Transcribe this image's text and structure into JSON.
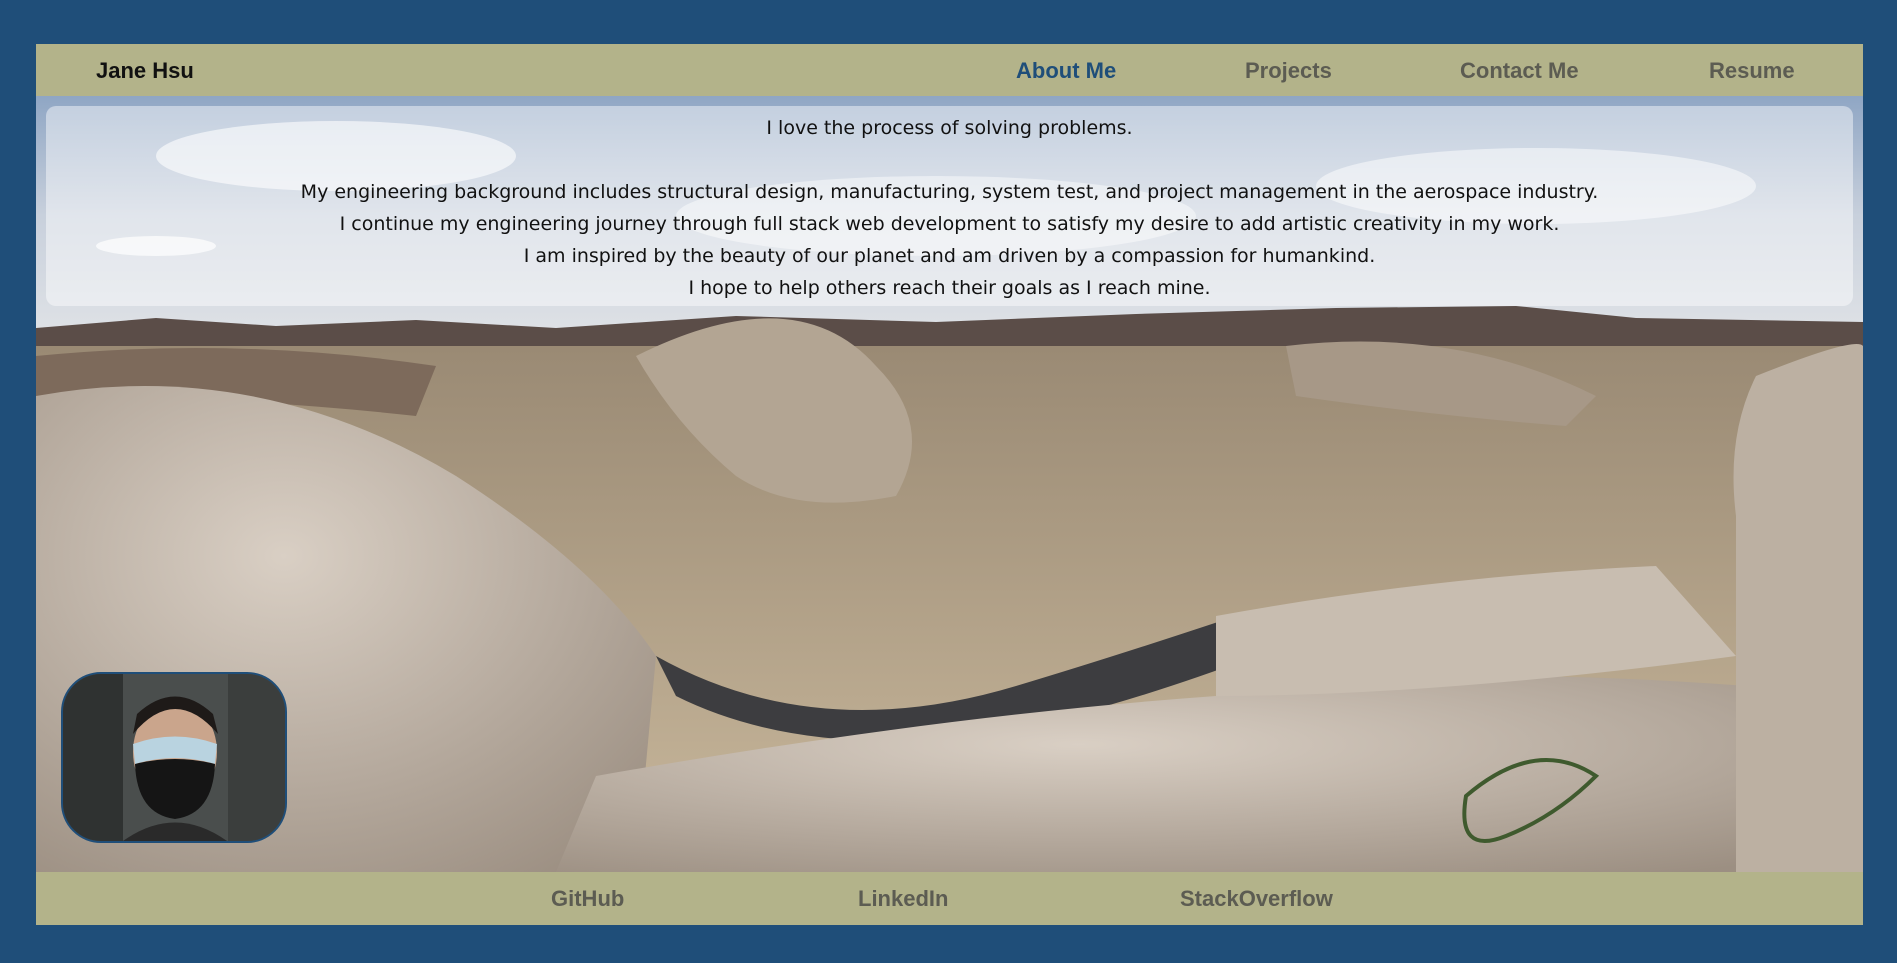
{
  "header": {
    "brand": "Jane Hsu",
    "nav": [
      {
        "label": "About Me",
        "active": true
      },
      {
        "label": "Projects",
        "active": false
      },
      {
        "label": "Contact Me",
        "active": false
      },
      {
        "label": "Resume",
        "active": false
      }
    ]
  },
  "intro": {
    "lead": "I love the process of solving problems.",
    "lines": [
      "My engineering background includes structural design, manufacturing, system test, and project management in the aerospace industry.",
      "I continue my engineering journey through full stack web development to satisfy my desire to add artistic creativity in my work.",
      "I am inspired by the beauty of our planet and am driven by a compassion for humankind.",
      "I hope to help others reach their goals as I reach mine."
    ]
  },
  "footer": {
    "links": [
      "GitHub",
      "LinkedIn",
      "StackOverflow"
    ]
  },
  "colors": {
    "page_background": "#1f4e79",
    "bar_background": "#b3b38a",
    "active_link": "#1f4e79",
    "link": "#5c5c52"
  }
}
